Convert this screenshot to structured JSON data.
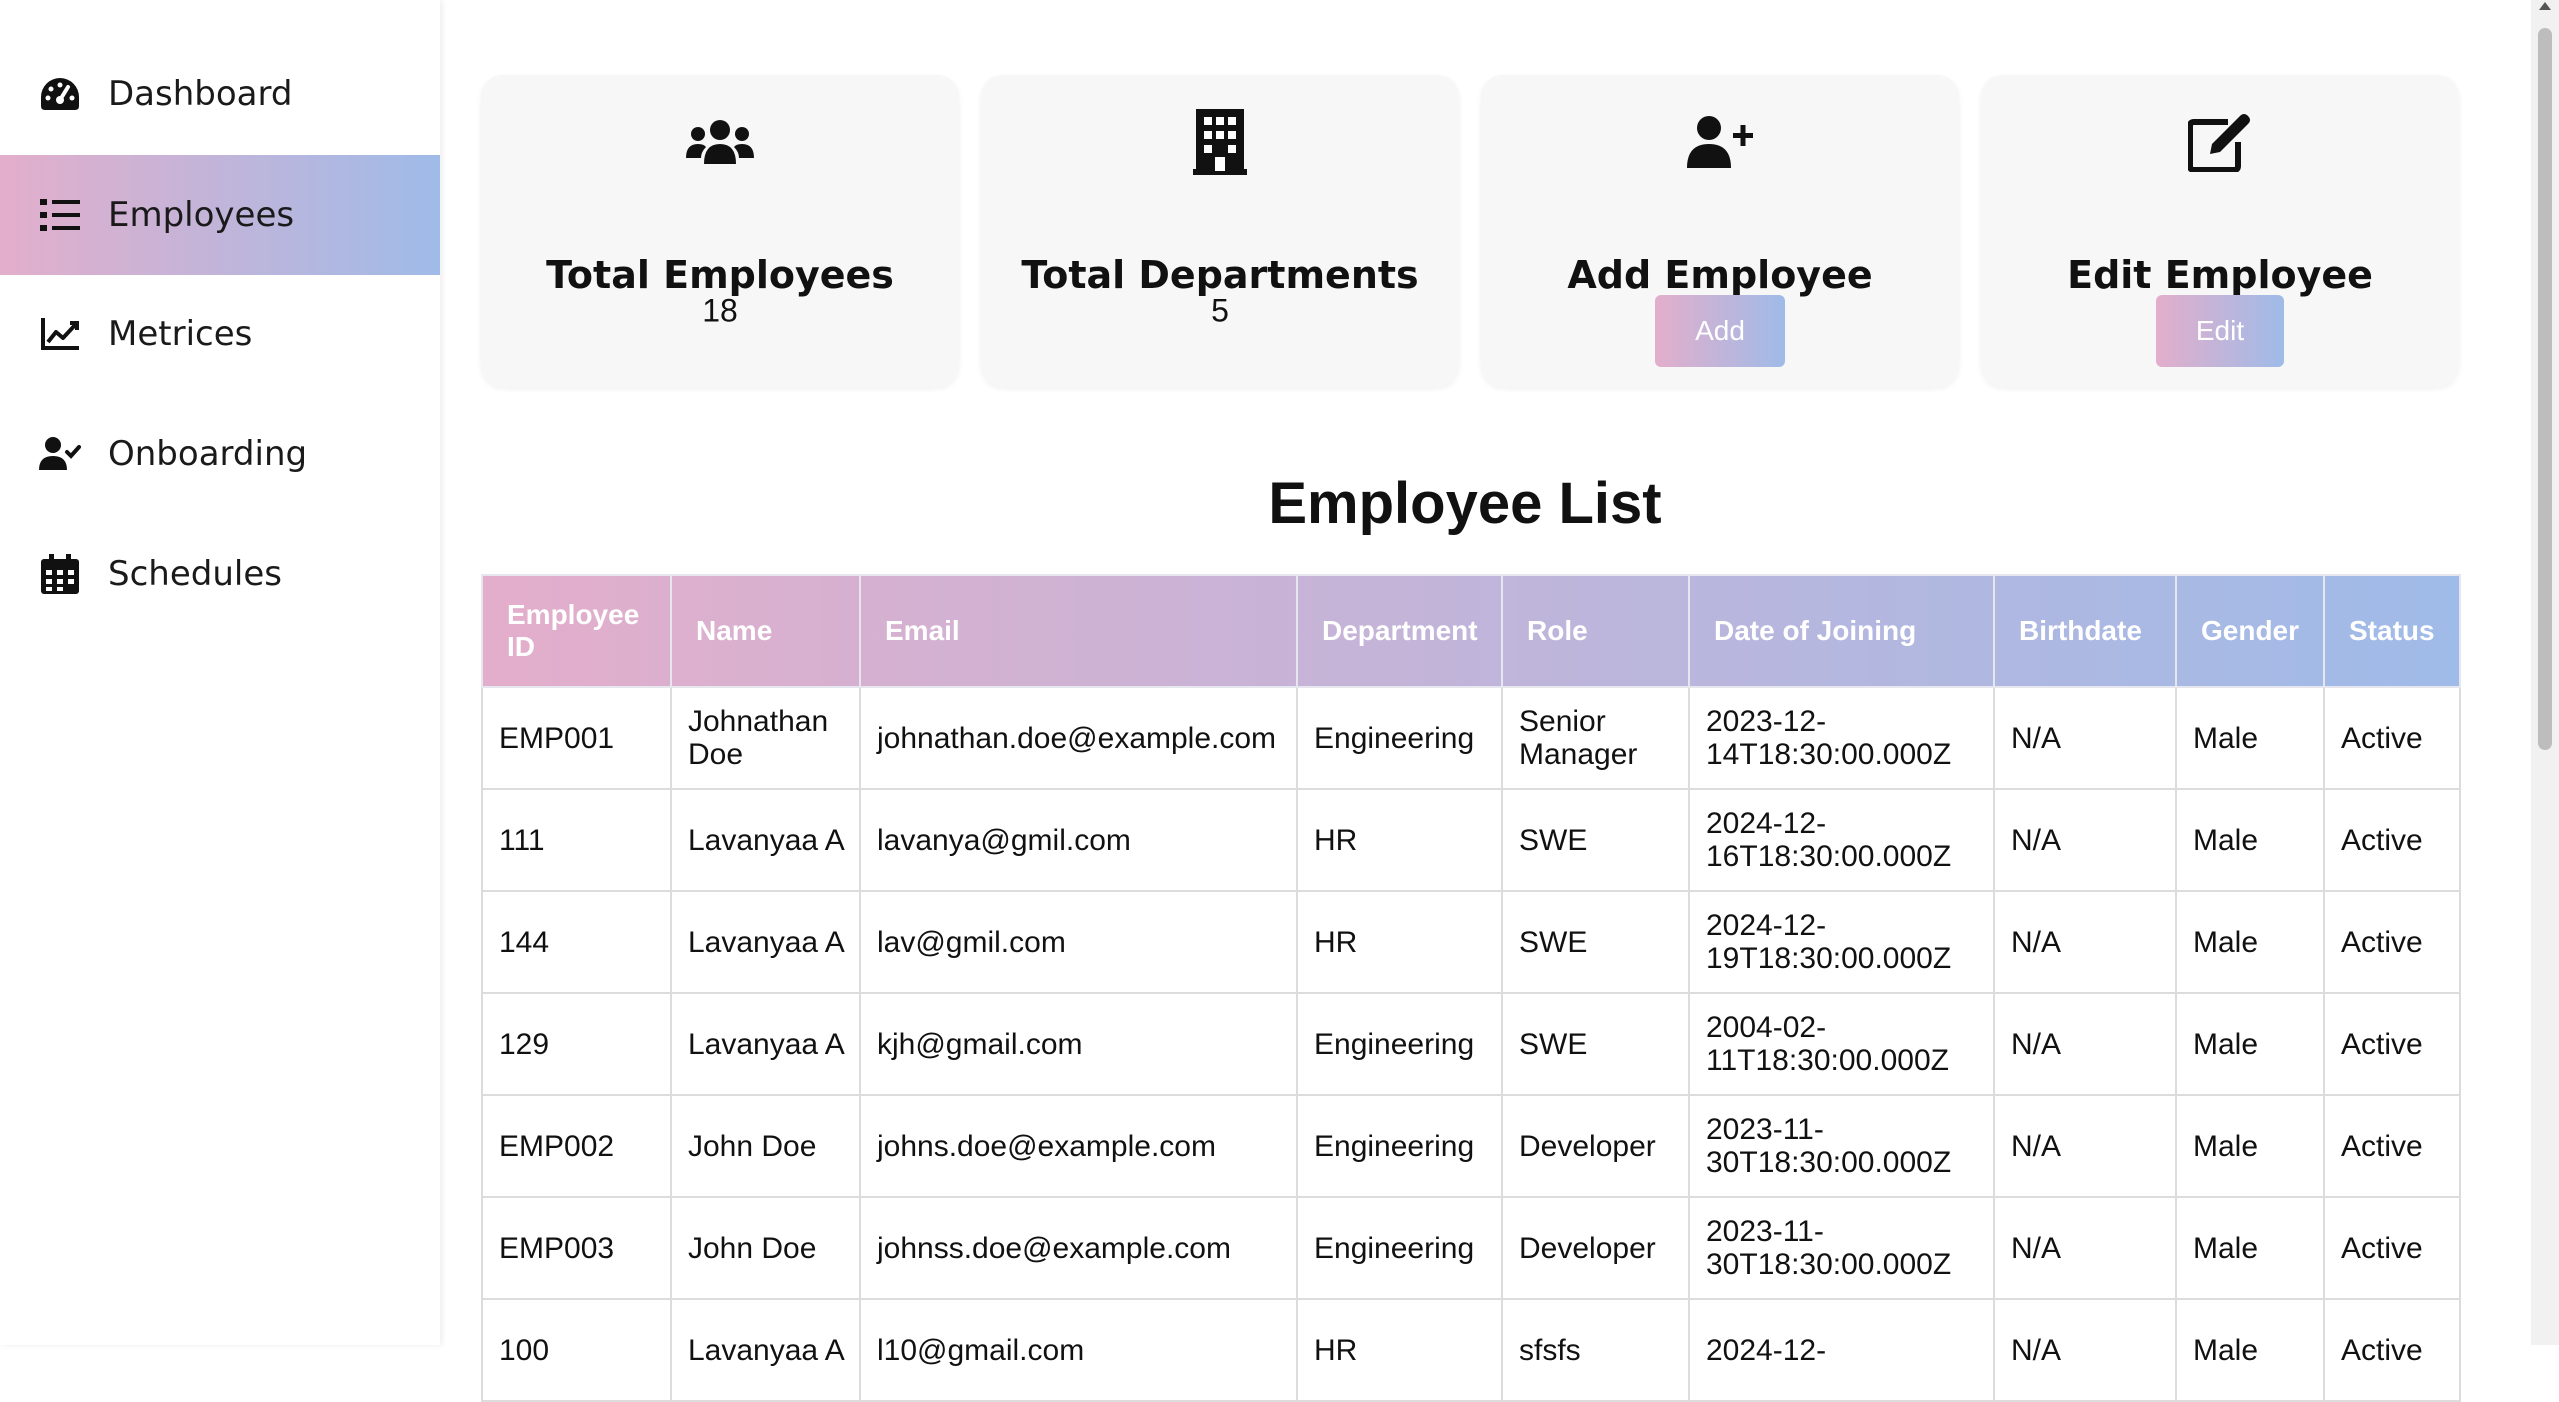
{
  "colors": {
    "gradient_start": "#e3aecb",
    "gradient_end": "#9fbbe8",
    "card_bg": "#f7f7f8"
  },
  "sidebar": {
    "items": [
      {
        "label": "Dashboard",
        "icon": "gauge-icon",
        "active": false
      },
      {
        "label": "Employees",
        "icon": "list-icon",
        "active": true
      },
      {
        "label": "Metrices",
        "icon": "chart-line-icon",
        "active": false
      },
      {
        "label": "Onboarding",
        "icon": "user-check-icon",
        "active": false
      },
      {
        "label": "Schedules",
        "icon": "calendar-icon",
        "active": false
      }
    ]
  },
  "cards": {
    "total_employees": {
      "title": "Total Employees",
      "value": "18",
      "icon": "users-icon"
    },
    "total_departments": {
      "title": "Total Departments",
      "value": "5",
      "icon": "building-icon"
    },
    "add_employee": {
      "title": "Add Employee",
      "button": "Add",
      "icon": "user-plus-icon"
    },
    "edit_employee": {
      "title": "Edit Employee",
      "button": "Edit",
      "icon": "edit-icon"
    }
  },
  "employee_list": {
    "title": "Employee List",
    "columns": [
      "Employee ID",
      "Name",
      "Email",
      "Department",
      "Role",
      "Date of Joining",
      "Birthdate",
      "Gender",
      "Status"
    ],
    "rows": [
      [
        "EMP001",
        "Johnathan Doe",
        "johnathan.doe@example.com",
        "Engineering",
        "Senior Manager",
        "2023-12-14T18:30:00.000Z",
        "N/A",
        "Male",
        "Active"
      ],
      [
        "111",
        "Lavanyaa A",
        "lavanya@gmil.com",
        "HR",
        "SWE",
        "2024-12-16T18:30:00.000Z",
        "N/A",
        "Male",
        "Active"
      ],
      [
        "144",
        "Lavanyaa A",
        "lav@gmil.com",
        "HR",
        "SWE",
        "2024-12-19T18:30:00.000Z",
        "N/A",
        "Male",
        "Active"
      ],
      [
        "129",
        "Lavanyaa A",
        "kjh@gmail.com",
        "Engineering",
        "SWE",
        "2004-02-11T18:30:00.000Z",
        "N/A",
        "Male",
        "Active"
      ],
      [
        "EMP002",
        "John Doe",
        "johns.doe@example.com",
        "Engineering",
        "Developer",
        "2023-11-30T18:30:00.000Z",
        "N/A",
        "Male",
        "Active"
      ],
      [
        "EMP003",
        "John Doe",
        "johnss.doe@example.com",
        "Engineering",
        "Developer",
        "2023-11-30T18:30:00.000Z",
        "N/A",
        "Male",
        "Active"
      ],
      [
        "100",
        "Lavanyaa A",
        "l10@gmail.com",
        "HR",
        "sfsfs",
        "2024-12-",
        "N/A",
        "Male",
        "Active"
      ]
    ]
  }
}
